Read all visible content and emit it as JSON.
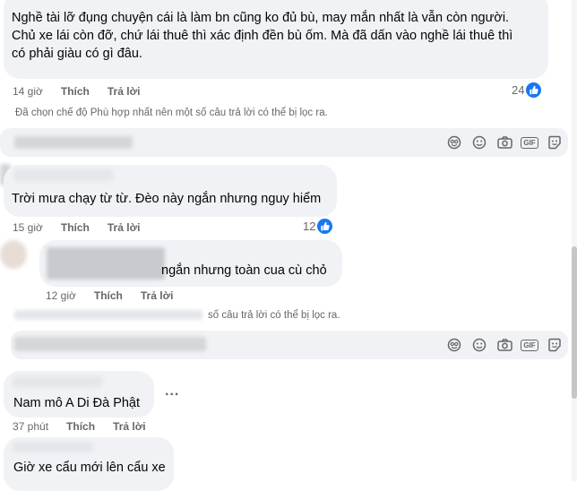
{
  "comments": [
    {
      "text": "Nghề tài lỡ đụng chuyện cái là làm bn cũng ko đủ bù, may mắn nhất là vẫn còn người.\nChủ xe lái còn đỡ, chứ lái thuê thì xác định đền bù ốm. Mà đã dấn vào nghề lái thuê thì\ncó phải giàu có gì đâu.",
      "time": "14 giờ",
      "like": "Thích",
      "reply": "Trả lời",
      "reactions": "24"
    },
    {
      "text": "Trời mưa chạy từ từ. Đèo này ngắn nhưng nguy hiểm",
      "time": "15 giờ",
      "like": "Thích",
      "reply": "Trả lời",
      "reactions": "12"
    },
    {
      "text": "ngắn nhưng toàn cua cù chỏ",
      "time": "12 giờ",
      "like": "Thích",
      "reply": "Trả lời"
    },
    {
      "text": "Nam mô A Di Đà Phật",
      "time": "37 phút",
      "like": "Thích",
      "reply": "Trả lời"
    },
    {
      "text": "Giờ xe cẩu mới lên cẩu xe"
    }
  ],
  "notices": {
    "first": "Đã chọn chế độ Phù hợp nhất nên một số câu trả lời có thể bị lọc ra.",
    "second": "số câu trả lời có thể bị lọc ra."
  },
  "more_label": "...",
  "input_icons": [
    "sticker-icon",
    "emoji-icon",
    "camera-icon",
    "gif-icon",
    "avatar-sticker-icon"
  ],
  "gif_label": "GIF",
  "colors": {
    "bubble": "#f0f2f5",
    "like_blue": "#1877f2",
    "meta_gray": "#65676b"
  }
}
